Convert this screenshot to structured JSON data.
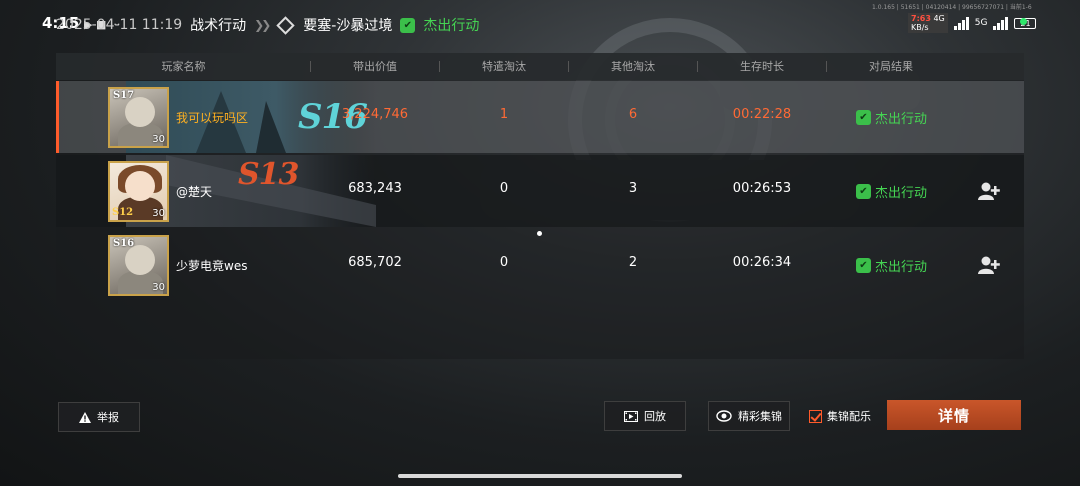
{
  "status_bar": {
    "time": "4:15",
    "icons": "▶ ■ ···",
    "network_speed_value": "7:63",
    "network_speed_unit": "4G",
    "network_speed_label": "KB/s",
    "network_type": "5G",
    "battery": "21",
    "mini_text": "1.0.165 | 51651 | 04120414 | 99656727071 | 当前1-6"
  },
  "header": {
    "datetime": "2025-04-11 11:19",
    "mode": "战术行动",
    "map": "要塞-沙暴过境",
    "result": "杰出行动"
  },
  "table": {
    "columns": [
      "玩家名称",
      "带出价值",
      "特遣淘汰",
      "其他淘汰",
      "生存时长",
      "对局结果"
    ],
    "rows": [
      {
        "name": "我可以玩吗区",
        "value": "3,224,746",
        "special_kills": "1",
        "other_kills": "6",
        "survival": "00:22:28",
        "result": "杰出行动",
        "level": "30",
        "avatar_tag": "S17",
        "banner_season": "S16",
        "highlighted": true
      },
      {
        "name": "@楚天",
        "value": "683,243",
        "special_kills": "0",
        "other_kills": "3",
        "survival": "00:26:53",
        "result": "杰出行动",
        "level": "30",
        "avatar_tag": "S12",
        "banner_season": "S13",
        "highlighted": false
      },
      {
        "name": "少萝电竟wes",
        "value": "685,702",
        "special_kills": "0",
        "other_kills": "2",
        "survival": "00:26:34",
        "result": "杰出行动",
        "level": "30",
        "avatar_tag": "S16",
        "banner_season": "",
        "highlighted": false
      }
    ]
  },
  "buttons": {
    "report": "举报",
    "replay": "回放",
    "highlights": "精彩集锦",
    "highlights_music": "集锦配乐",
    "details": "详情"
  },
  "colors": {
    "accent": "#ff5c2b",
    "success": "#45d453",
    "highlight_name": "#ffb020",
    "highlight_value": "#ff6a35"
  }
}
